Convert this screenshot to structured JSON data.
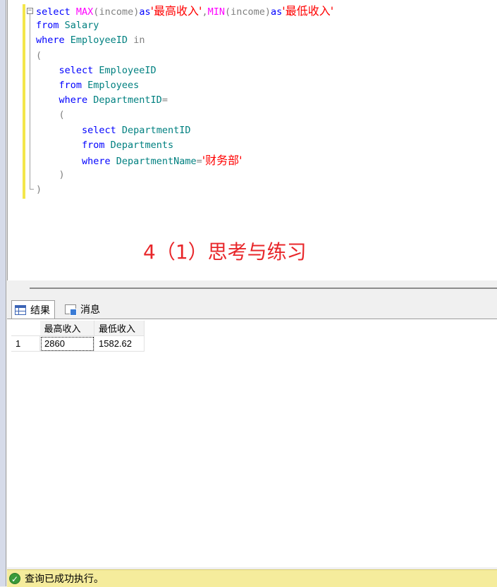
{
  "editor": {
    "lines": [
      {
        "tokens": [
          {
            "t": "select ",
            "c": "kw"
          },
          {
            "t": "MAX",
            "c": "fn"
          },
          {
            "t": "(",
            "c": "gr"
          },
          {
            "t": "income",
            "c": "gr"
          },
          {
            "t": ")",
            "c": "gr"
          },
          {
            "t": "as",
            "c": "kw"
          },
          {
            "t": "'最高收入'",
            "c": "st cjk"
          },
          {
            "t": ",",
            "c": "gr"
          },
          {
            "t": "MIN",
            "c": "fn"
          },
          {
            "t": "(",
            "c": "gr"
          },
          {
            "t": "income",
            "c": "gr"
          },
          {
            "t": ")",
            "c": "gr"
          },
          {
            "t": "as",
            "c": "kw"
          },
          {
            "t": "'最低收入'",
            "c": "st cjk"
          }
        ]
      },
      {
        "tokens": [
          {
            "t": "from ",
            "c": "kw"
          },
          {
            "t": "Salary",
            "c": "tx"
          }
        ]
      },
      {
        "tokens": [
          {
            "t": "where ",
            "c": "kw"
          },
          {
            "t": "EmployeeID ",
            "c": "tx"
          },
          {
            "t": "in",
            "c": "gr"
          }
        ]
      },
      {
        "tokens": [
          {
            "t": "(",
            "c": "gr"
          }
        ]
      },
      {
        "tokens": [
          {
            "t": "    select ",
            "c": "kw"
          },
          {
            "t": "EmployeeID",
            "c": "tx"
          }
        ]
      },
      {
        "tokens": [
          {
            "t": "    from ",
            "c": "kw"
          },
          {
            "t": "Employees",
            "c": "tx"
          }
        ]
      },
      {
        "tokens": [
          {
            "t": "    where ",
            "c": "kw"
          },
          {
            "t": "DepartmentID",
            "c": "tx"
          },
          {
            "t": "=",
            "c": "gr"
          }
        ]
      },
      {
        "tokens": [
          {
            "t": "    (",
            "c": "gr"
          }
        ]
      },
      {
        "tokens": [
          {
            "t": "        select ",
            "c": "kw"
          },
          {
            "t": "DepartmentID",
            "c": "tx"
          }
        ]
      },
      {
        "tokens": [
          {
            "t": "        from ",
            "c": "kw"
          },
          {
            "t": "Departments",
            "c": "tx"
          }
        ]
      },
      {
        "tokens": [
          {
            "t": "        where ",
            "c": "kw"
          },
          {
            "t": "DepartmentName",
            "c": "tx"
          },
          {
            "t": "=",
            "c": "gr"
          },
          {
            "t": "'财务部'",
            "c": "st cjk"
          }
        ]
      },
      {
        "tokens": [
          {
            "t": "    )",
            "c": "gr"
          }
        ]
      },
      {
        "tokens": [
          {
            "t": ")",
            "c": "gr"
          }
        ]
      }
    ],
    "fold_marker": "−",
    "annotation": "4（1）思考与练习"
  },
  "tabs": {
    "results_label": "结果",
    "messages_label": "消息"
  },
  "grid": {
    "columns": [
      "最高收入",
      "最低收入"
    ],
    "rows": [
      {
        "num": "1",
        "cells": [
          "2860",
          "1582.62"
        ]
      }
    ]
  },
  "status": {
    "message": "查询已成功执行。"
  }
}
